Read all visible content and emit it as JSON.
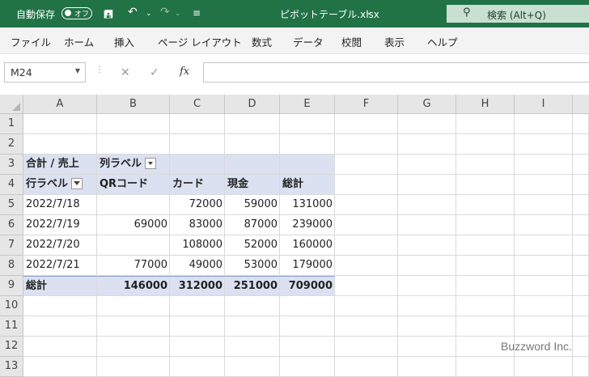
{
  "titlebar": {
    "autosave_label": "自動保存",
    "toggle_state": "オフ",
    "filename": "ピボットテーブル.xlsx",
    "search_placeholder": "検索 (Alt+Q)"
  },
  "menu": [
    "ファイル",
    "ホーム",
    "挿入",
    "ページ レイアウト",
    "数式",
    "データ",
    "校閲",
    "表示",
    "ヘルプ"
  ],
  "formula_bar": {
    "name_box": "M24",
    "fx": "fx",
    "formula": ""
  },
  "columns": [
    "A",
    "B",
    "C",
    "D",
    "E",
    "F",
    "G",
    "H",
    "I"
  ],
  "rows": [
    "1",
    "2",
    "3",
    "4",
    "5",
    "6",
    "7",
    "8",
    "9",
    "10",
    "11",
    "12",
    "13"
  ],
  "pivot": {
    "value_field": "合計 / 売上",
    "column_labels": "列ラベル",
    "row_labels": "行ラベル",
    "headers": [
      "QRコード",
      "カード",
      "現金",
      "総計"
    ],
    "data_rows": [
      {
        "label": "2022/7/18",
        "values": [
          "",
          "72000",
          "59000",
          "131000"
        ]
      },
      {
        "label": "2022/7/19",
        "values": [
          "69000",
          "83000",
          "87000",
          "239000"
        ]
      },
      {
        "label": "2022/7/20",
        "values": [
          "",
          "108000",
          "52000",
          "160000"
        ]
      },
      {
        "label": "2022/7/21",
        "values": [
          "77000",
          "49000",
          "53000",
          "179000"
        ]
      }
    ],
    "grand_total": {
      "label": "総計",
      "values": [
        "146000",
        "312000",
        "251000",
        "709000"
      ]
    }
  },
  "watermark": "Buzzword Inc.",
  "colors": {
    "title_bar": "#217346",
    "pivot_fill": "#dbe1f1"
  }
}
